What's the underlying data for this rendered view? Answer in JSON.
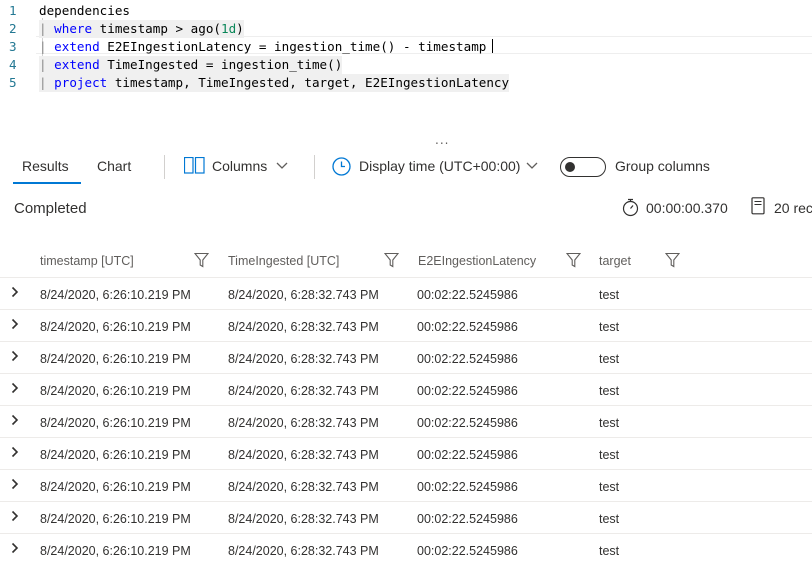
{
  "editor": {
    "lines": [
      {
        "num": "1",
        "segments": [
          {
            "t": "dependencies",
            "c": "plain"
          }
        ]
      },
      {
        "num": "2",
        "segments": [
          {
            "t": "| ",
            "c": "pipe"
          },
          {
            "t": "where",
            "c": "kw"
          },
          {
            "t": " timestamp > ago(",
            "c": "plain"
          },
          {
            "t": "1d",
            "c": "num"
          },
          {
            "t": ")",
            "c": "plain"
          }
        ]
      },
      {
        "num": "3",
        "segments": [
          {
            "t": "| ",
            "c": "pipe"
          },
          {
            "t": "extend",
            "c": "kw"
          },
          {
            "t": " E2EIngestionLatency = ingestion_time() - timestamp",
            "c": "plain"
          }
        ]
      },
      {
        "num": "4",
        "segments": [
          {
            "t": "| ",
            "c": "pipe"
          },
          {
            "t": "extend",
            "c": "kw"
          },
          {
            "t": " TimeIngested = ingestion_time()",
            "c": "plain"
          }
        ]
      },
      {
        "num": "5",
        "segments": [
          {
            "t": "| ",
            "c": "pipe"
          },
          {
            "t": "project",
            "c": "kw"
          },
          {
            "t": " timestamp, TimeIngested, target, E2EIngestionLatency",
            "c": "plain"
          }
        ]
      }
    ],
    "splitter": "..."
  },
  "toolbar": {
    "tab_results": "Results",
    "tab_chart": "Chart",
    "columns_label": "Columns",
    "display_time_label": "Display time (UTC+00:00)",
    "group_columns_label": "Group columns",
    "group_columns_on": false
  },
  "status": {
    "text": "Completed",
    "elapsed": "00:00:00.370",
    "records": "20 rec"
  },
  "grid": {
    "columns": [
      "timestamp [UTC]",
      "TimeIngested [UTC]",
      "E2EIngestionLatency",
      "target"
    ],
    "rows": [
      [
        "8/24/2020, 6:26:10.219 PM",
        "8/24/2020, 6:28:32.743 PM",
        "00:02:22.5245986",
        "test"
      ],
      [
        "8/24/2020, 6:26:10.219 PM",
        "8/24/2020, 6:28:32.743 PM",
        "00:02:22.5245986",
        "test"
      ],
      [
        "8/24/2020, 6:26:10.219 PM",
        "8/24/2020, 6:28:32.743 PM",
        "00:02:22.5245986",
        "test"
      ],
      [
        "8/24/2020, 6:26:10.219 PM",
        "8/24/2020, 6:28:32.743 PM",
        "00:02:22.5245986",
        "test"
      ],
      [
        "8/24/2020, 6:26:10.219 PM",
        "8/24/2020, 6:28:32.743 PM",
        "00:02:22.5245986",
        "test"
      ],
      [
        "8/24/2020, 6:26:10.219 PM",
        "8/24/2020, 6:28:32.743 PM",
        "00:02:22.5245986",
        "test"
      ],
      [
        "8/24/2020, 6:26:10.219 PM",
        "8/24/2020, 6:28:32.743 PM",
        "00:02:22.5245986",
        "test"
      ],
      [
        "8/24/2020, 6:26:10.219 PM",
        "8/24/2020, 6:28:32.743 PM",
        "00:02:22.5245986",
        "test"
      ],
      [
        "8/24/2020, 6:26:10.219 PM",
        "8/24/2020, 6:28:32.743 PM",
        "00:02:22.5245986",
        "test"
      ]
    ]
  },
  "colors": {
    "accent": "#0078d4",
    "keyword": "#0000ff",
    "number": "#098658",
    "line_number": "#237893"
  },
  "icons": {
    "columns": "columns-icon",
    "clock": "clock-icon",
    "stopwatch": "stopwatch-icon",
    "records": "records-icon",
    "filter": "filter-icon",
    "expand": "chevron-right-icon"
  }
}
